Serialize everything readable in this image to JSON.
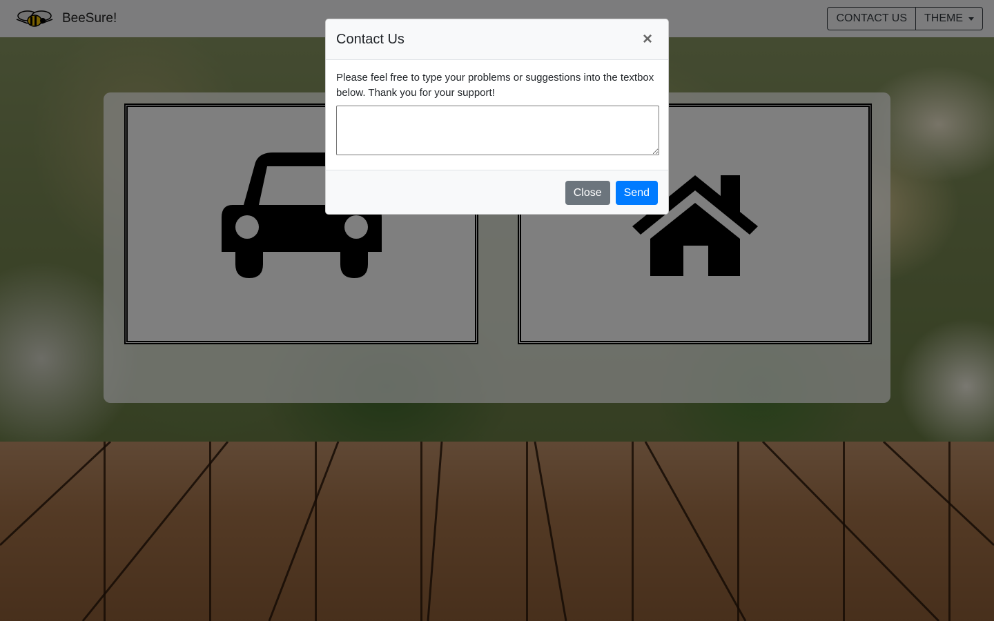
{
  "navbar": {
    "brand": "BeeSure!",
    "logo_icon": "bee-icon",
    "contact_label": "CONTACT US",
    "theme_label": "THEME"
  },
  "cards": [
    {
      "icon": "car-icon"
    },
    {
      "icon": "home-icon"
    }
  ],
  "modal": {
    "title": "Contact Us",
    "close_symbol": "×",
    "text": "Please feel free to type your problems or suggestions into the textbox below. Thank you for your support!",
    "textarea_value": "",
    "close_label": "Close",
    "send_label": "Send"
  },
  "colors": {
    "primary": "#007bff",
    "secondary": "#6c757d",
    "navbar_bg": "#f8f9fa"
  }
}
